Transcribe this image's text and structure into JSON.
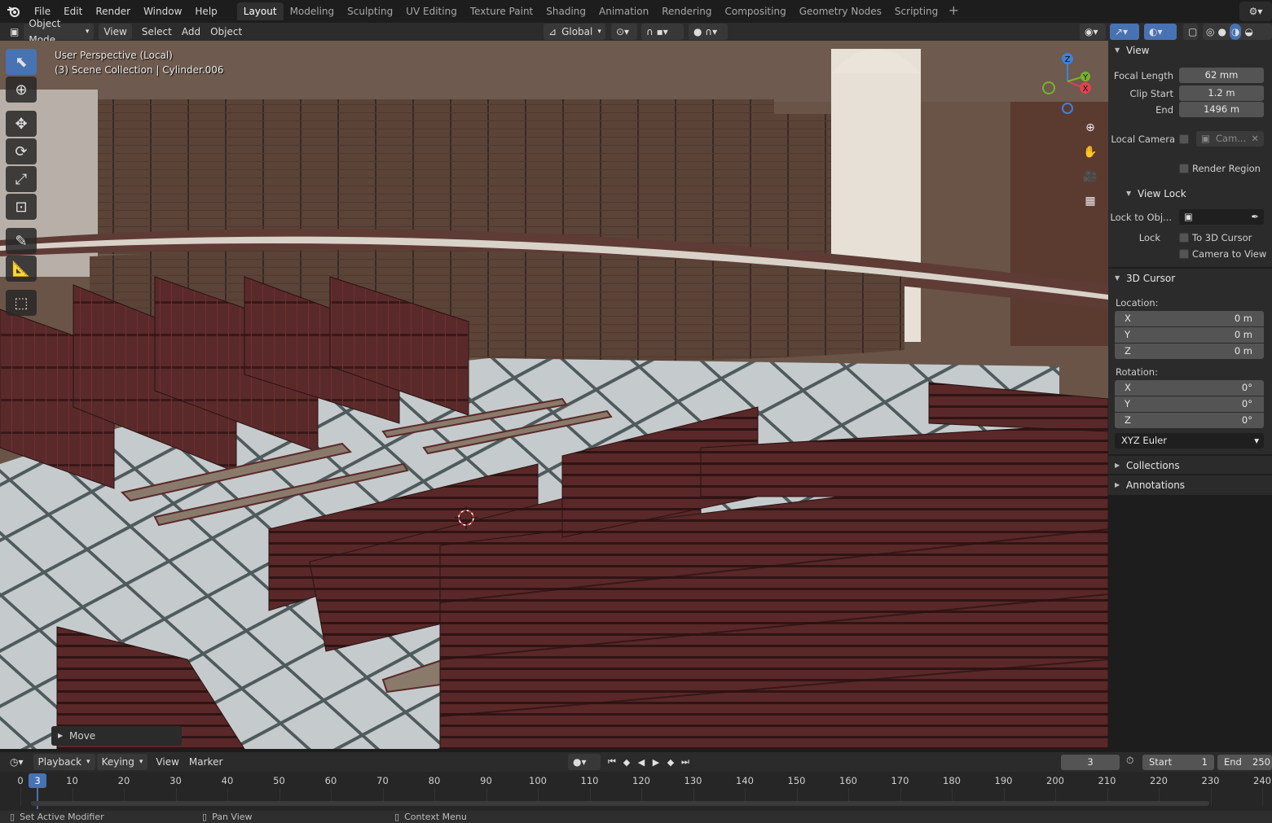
{
  "topbar": {
    "logo_icon": "blender-logo-icon",
    "menus": [
      "File",
      "Edit",
      "Render",
      "Window",
      "Help"
    ],
    "workspaces": [
      "Layout",
      "Modeling",
      "Sculpting",
      "UV Editing",
      "Texture Paint",
      "Shading",
      "Animation",
      "Rendering",
      "Compositing",
      "Geometry Nodes",
      "Scripting"
    ],
    "active_workspace": "Layout",
    "add_workspace": "+"
  },
  "viewport_header": {
    "mode": "Object Mode",
    "menus": [
      "View",
      "Select",
      "Add",
      "Object"
    ],
    "orientation": "Global"
  },
  "viewport": {
    "perspective_label": "User Perspective (Local)",
    "collection_label": "(3) Scene Collection | Cylinder.006",
    "gizmo_axes": {
      "z": "Z",
      "y": "Y",
      "x": "X"
    },
    "last_operator": "Move"
  },
  "sidebar": {
    "view_section": "View",
    "focal_length_label": "Focal Length",
    "focal_length": "62 mm",
    "clip_start_label": "Clip Start",
    "clip_start": "1.2 m",
    "clip_end_label": "End",
    "clip_end": "1496 m",
    "local_camera_label": "Local Camera",
    "local_camera_value": "Cam...",
    "render_region_label": "Render Region",
    "view_lock_section": "View Lock",
    "lock_to_obj_label": "Lock to Obj...",
    "lock_label": "Lock",
    "to_3d_cursor_label": "To 3D Cursor",
    "camera_to_view_label": "Camera to View",
    "cursor_section": "3D Cursor",
    "location_label": "Location:",
    "location": [
      {
        "axis": "X",
        "value": "0 m"
      },
      {
        "axis": "Y",
        "value": "0 m"
      },
      {
        "axis": "Z",
        "value": "0 m"
      }
    ],
    "rotation_label": "Rotation:",
    "rotation": [
      {
        "axis": "X",
        "value": "0°"
      },
      {
        "axis": "Y",
        "value": "0°"
      },
      {
        "axis": "Z",
        "value": "0°"
      }
    ],
    "rotation_mode": "XYZ Euler",
    "collections_section": "Collections",
    "annotations_section": "Annotations"
  },
  "timeline": {
    "menus": [
      "Playback",
      "Keying",
      "View",
      "Marker"
    ],
    "current_frame": "3",
    "start_label": "Start",
    "start": "1",
    "end_label": "End",
    "end": "250",
    "ticks": [
      "0",
      "10",
      "20",
      "30",
      "40",
      "50",
      "60",
      "70",
      "80",
      "90",
      "100",
      "110",
      "120",
      "130",
      "140",
      "150",
      "160",
      "170",
      "180",
      "190",
      "200",
      "210",
      "220",
      "230",
      "240"
    ]
  },
  "statusbar": {
    "items": [
      "Set Active Modifier",
      "Pan View",
      "Context Menu"
    ]
  },
  "colors": {
    "accent": "#4772b3",
    "active_frame": "#4772b3",
    "axis_x": "#e0424f",
    "axis_y": "#7ab32b",
    "axis_z": "#3d82d9"
  }
}
